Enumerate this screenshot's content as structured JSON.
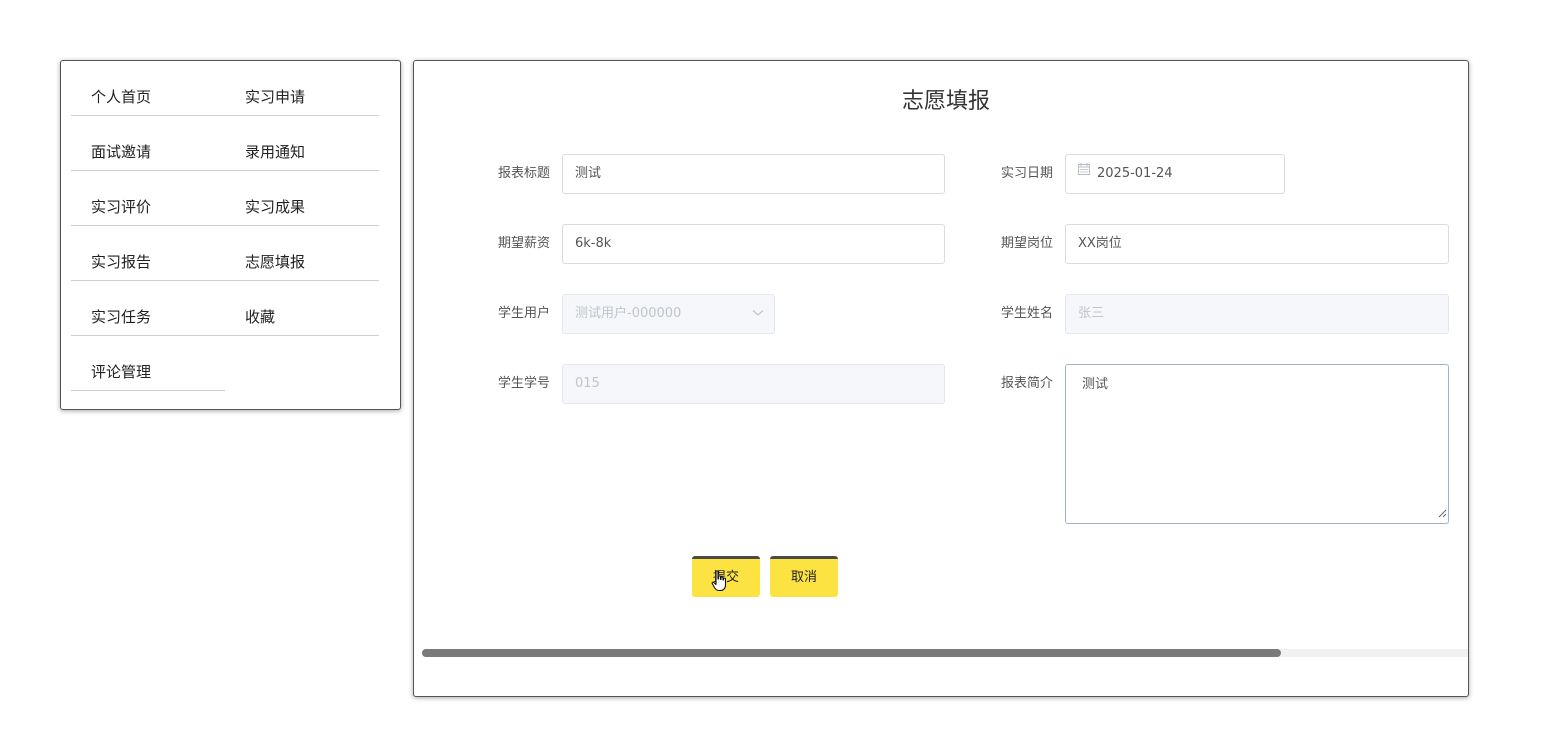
{
  "menu": {
    "items": [
      {
        "label": "个人首页"
      },
      {
        "label": "实习申请"
      },
      {
        "label": "面试邀请"
      },
      {
        "label": "录用通知"
      },
      {
        "label": "实习评价"
      },
      {
        "label": "实习成果"
      },
      {
        "label": "实习报告"
      },
      {
        "label": "志愿填报"
      },
      {
        "label": "实习任务"
      },
      {
        "label": "收藏"
      },
      {
        "label": "评论管理"
      }
    ]
  },
  "form": {
    "title": "志愿填报",
    "fields": {
      "report_title": {
        "label": "报表标题",
        "value": "测试"
      },
      "internship_date": {
        "label": "实习日期",
        "value": "2025-01-24"
      },
      "expected_salary": {
        "label": "期望薪资",
        "value": "6k-8k"
      },
      "expected_position": {
        "label": "期望岗位",
        "value": "XX岗位"
      },
      "student_user": {
        "label": "学生用户",
        "value": "测试用户-000000"
      },
      "student_name": {
        "label": "学生姓名",
        "value": "张三"
      },
      "student_id": {
        "label": "学生学号",
        "value": "015"
      },
      "report_intro": {
        "label": "报表简介",
        "value": "测试"
      }
    },
    "buttons": {
      "submit_label": "提交",
      "cancel_label": "取消"
    }
  },
  "icons": {
    "date": "calendar-icon",
    "select": "chevron-down-icon",
    "cursor": "hand-pointer-icon"
  },
  "colors": {
    "button_bg": "#fde342",
    "button_top_border": "#4a4a4a",
    "disabled_bg": "#f5f7fa",
    "scrollbar_thumb": "#7a7a7a"
  },
  "scroll": {
    "horizontal_position_fraction": 0.82
  }
}
